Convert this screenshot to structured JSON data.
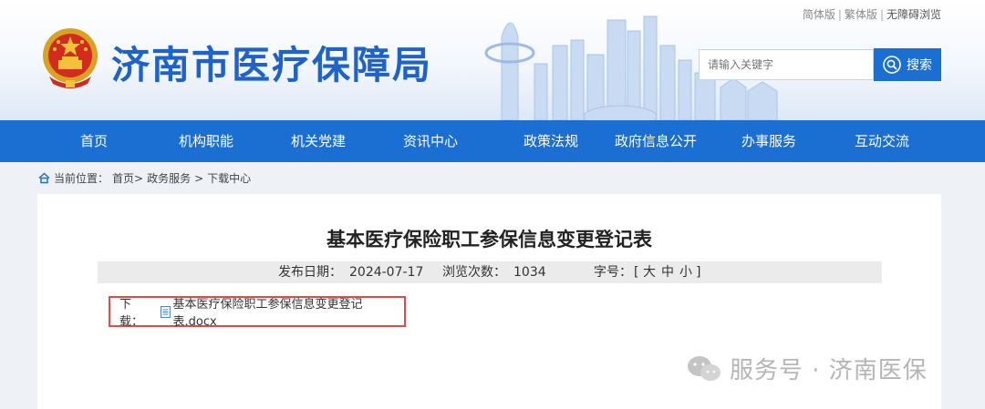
{
  "header": {
    "site_title": "济南市医疗保障局",
    "top_links": [
      "简体版",
      "繁体版",
      "无障碍浏览"
    ],
    "search": {
      "placeholder": "请输入关键字",
      "button_label": "搜索"
    }
  },
  "nav": {
    "items": [
      "首页",
      "机构职能",
      "机关党建",
      "资讯中心",
      "政策法规",
      "政府信息公开",
      "办事服务",
      "互动交流"
    ]
  },
  "breadcrumb": {
    "prefix": "当前位置：",
    "items": [
      "首页>",
      "政务服务",
      ">",
      "下载中心"
    ]
  },
  "article": {
    "title": "基本医疗保险职工参保信息变更登记表",
    "publish_label": "发布日期：",
    "publish_date": "2024-07-17",
    "views_label": "浏览次数：",
    "views": "1034",
    "font_label": "字号：",
    "font_open": "[",
    "font_sizes": [
      "大",
      "中",
      "小"
    ],
    "font_close": "]",
    "download_label": "下载：",
    "download_file": "基本医疗保险职工参保信息变更登记表.docx"
  },
  "watermark": {
    "text": "服务号 · 济南医保"
  },
  "colors": {
    "brand_blue": "#1b6fd3",
    "title_blue": "#1f63c8",
    "highlight_red": "#e14a4a"
  },
  "icons": [
    "national-emblem",
    "search-icon",
    "home-icon",
    "docx-file-icon",
    "wechat-icon"
  ]
}
